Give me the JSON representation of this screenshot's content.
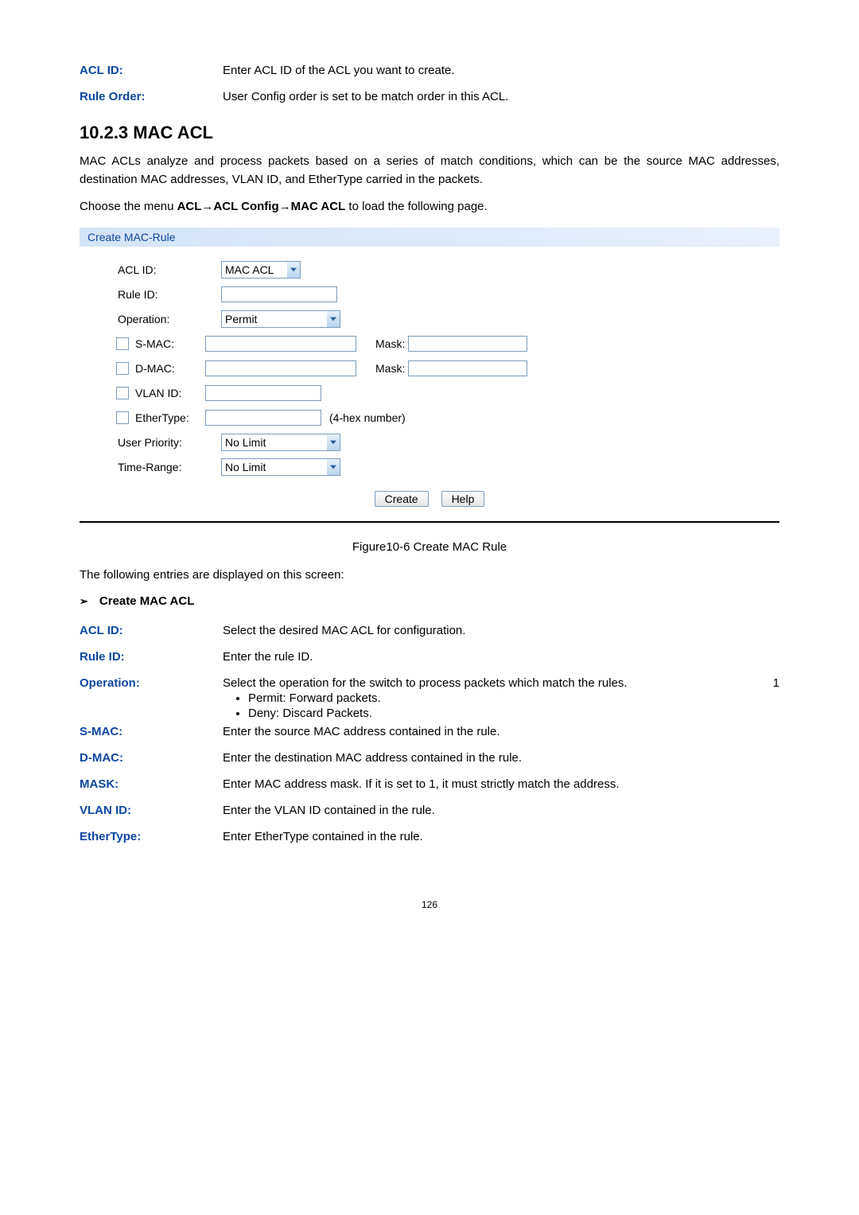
{
  "top_fields": {
    "acl_id": {
      "label": "ACL ID:",
      "desc": "Enter ACL ID of the ACL you want to create."
    },
    "rule_order": {
      "label": "Rule Order:",
      "desc": "User Config order is set to be match order in this ACL."
    }
  },
  "section": {
    "number": "10.2.3",
    "title": "MAC ACL",
    "para": "MAC ACLs analyze and process packets based on a series of match conditions, which can be the source MAC addresses, destination MAC addresses, VLAN ID, and EtherType carried in the packets.",
    "menu_prefix": "Choose the menu ",
    "menu_bold1": "ACL",
    "menu_arrow": "→",
    "menu_bold2": "ACL Config",
    "menu_bold3": "MAC ACL",
    "menu_suffix": " to load the following page."
  },
  "figure": {
    "header": "Create MAC-Rule",
    "labels": {
      "acl_id": "ACL ID:",
      "rule_id": "Rule ID:",
      "operation": "Operation:",
      "smac": "S-MAC:",
      "dmac": "D-MAC:",
      "vlan_id": "VLAN ID:",
      "ethertype": "EtherType:",
      "user_priority": "User Priority:",
      "time_range": "Time-Range:",
      "mask": "Mask:",
      "hex_hint": "(4-hex number)"
    },
    "selects": {
      "acl_id": "MAC ACL",
      "operation": "Permit",
      "user_priority": "No Limit",
      "time_range": "No Limit"
    },
    "buttons": {
      "create": "Create",
      "help": "Help"
    },
    "caption": "Figure10-6 Create MAC Rule"
  },
  "entries_intro": "The following entries are displayed on this screen:",
  "subheading": "Create MAC ACL",
  "bottom_fields": {
    "acl_id": {
      "label": "ACL ID:",
      "desc": "Select the desired MAC ACL for configuration."
    },
    "rule_id": {
      "label": "Rule ID:",
      "desc": "Enter the rule ID."
    },
    "operation": {
      "label": "Operation:",
      "desc": "Select the operation for the switch to process packets which match the rules.",
      "right_num": "1",
      "bullet1": "Permit: Forward packets.",
      "bullet2": "Deny: Discard Packets."
    },
    "smac": {
      "label": "S-MAC:",
      "desc": "Enter the source MAC address contained in the rule."
    },
    "dmac": {
      "label": "D-MAC:",
      "desc": "Enter the destination MAC address contained in the rule."
    },
    "mask": {
      "label": "MASK:",
      "desc": "Enter MAC address mask. If it is set to 1, it must strictly match the address."
    },
    "vlan_id": {
      "label": "VLAN ID:",
      "desc": "Enter the VLAN ID contained in the rule."
    },
    "ethertype": {
      "label": "EtherType:",
      "desc": "Enter EtherType contained in the rule."
    }
  },
  "page_number": "126"
}
